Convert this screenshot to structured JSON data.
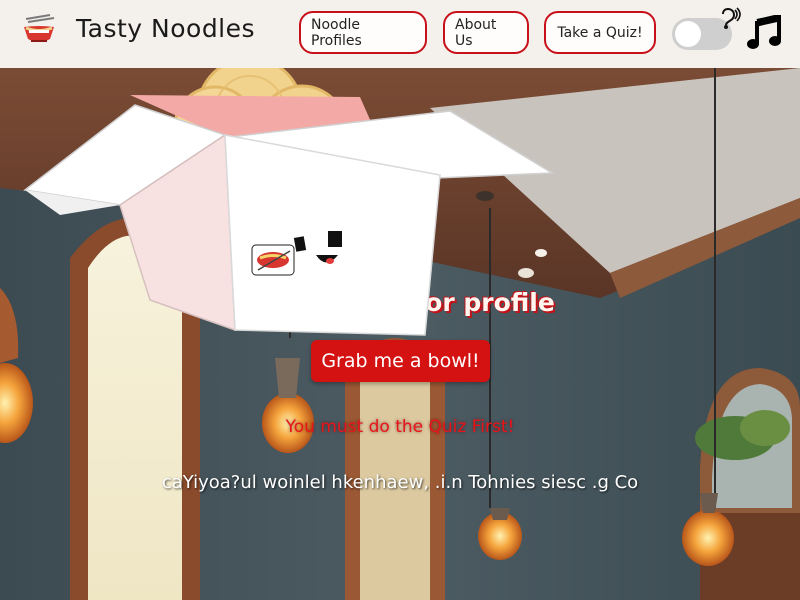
{
  "header": {
    "site_title": "Tasty Noodles",
    "nav": [
      {
        "label": "Noodle Profiles"
      },
      {
        "label": "About Us"
      },
      {
        "label": "Take a Quiz!"
      }
    ],
    "sound_toggle": {
      "state": "off"
    },
    "icons": [
      "noodle-bowl-logo-icon",
      "hearing-icon",
      "music-note-icon"
    ]
  },
  "hero": {
    "heading_visible": "avor profile",
    "cta_label": "Grab me a bowl!",
    "warning": "You must do the Quiz First!",
    "scrambled_text": "caYiyoa?ul woinlel hkenhaew, .i.n Tohnies siesc .g Co"
  },
  "colors": {
    "accent_red": "#d41212",
    "nav_border": "#c8101a",
    "nav_bg": "#f4f1ec"
  }
}
